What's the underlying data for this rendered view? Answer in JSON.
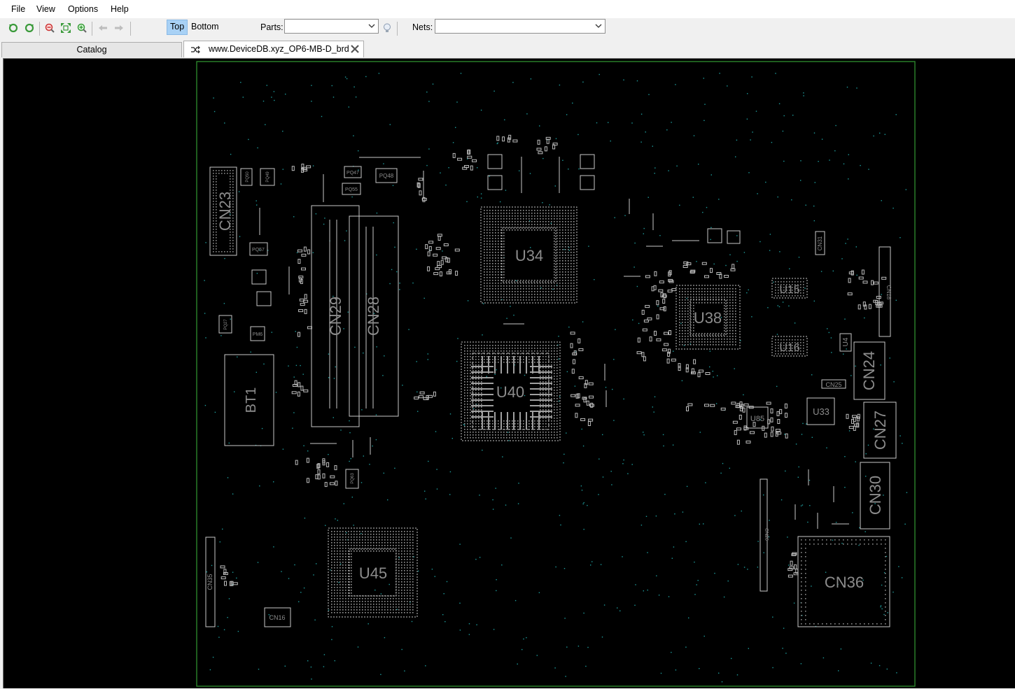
{
  "menu": {
    "file": "File",
    "view": "View",
    "options": "Options",
    "help": "Help"
  },
  "toolbar": {
    "side_top": "Top",
    "side_bottom": "Bottom",
    "parts_label": "Parts:",
    "parts_value": "",
    "nets_label": "Nets:",
    "nets_value": ""
  },
  "tabs": {
    "catalog": "Catalog",
    "board": "www.DeviceDB.xyz_OP6-MB-D_brd"
  },
  "colors": {
    "board_outline": "#2f8f2f",
    "part_outline": "#c8c8c8",
    "label": "#8c8c8c",
    "via": "#1e9c9c",
    "active_side": "#a8d1f5"
  },
  "board": {
    "components": [
      "CN23",
      "CN29",
      "CN28",
      "BT1",
      "U34",
      "U40",
      "U38",
      "U15",
      "U16",
      "CN24",
      "CN25",
      "U33",
      "U85",
      "CN27",
      "CN30",
      "CN36",
      "U45",
      "CN35",
      "CN16",
      "CN31",
      "CN18",
      "CN26",
      "U4"
    ],
    "small_labels": [
      "PQ50",
      "PQ49",
      "PQ47",
      "PQ48",
      "PQ55",
      "PQ57",
      "PQ27",
      "PM6",
      "PQ63"
    ]
  }
}
